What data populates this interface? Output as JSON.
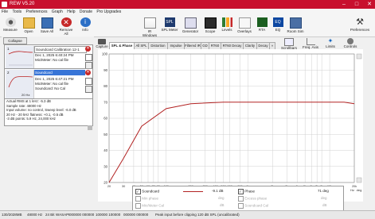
{
  "window": {
    "title": "REW V5.20"
  },
  "menu": [
    "File",
    "Tools",
    "Preferences",
    "Graph",
    "Help",
    "Donate",
    "Pro Upgrades"
  ],
  "toolbar": [
    {
      "label": "Measure",
      "icon": "measure-icon"
    },
    {
      "label": "Open",
      "icon": "open-icon"
    },
    {
      "label": "Save All",
      "icon": "save-icon"
    },
    {
      "label": "Remove All",
      "icon": "remove-icon"
    },
    {
      "label": "Info",
      "icon": "info-icon"
    }
  ],
  "toolbar_right": [
    {
      "label": "IR Windows",
      "icon": "ir-windows-icon"
    },
    {
      "label": "SPL Meter",
      "icon": "spl-meter-icon"
    },
    {
      "label": "Generator",
      "icon": "generator-icon"
    },
    {
      "label": "Scope",
      "icon": "scope-icon"
    },
    {
      "label": "Levels",
      "icon": "levels-icon"
    },
    {
      "label": "Overlays",
      "icon": "overlays-icon"
    },
    {
      "label": "RTA",
      "icon": "rta-icon"
    },
    {
      "label": "EQ",
      "icon": "eq-icon"
    },
    {
      "label": "Room Sim",
      "icon": "room-sim-icon"
    }
  ],
  "preferences_label": "Preferences",
  "collapse_label": "Collapse",
  "measurements": [
    {
      "name": "Soundcard Calibration 12-1",
      "date": "Dec 1, 2025 6:40:24 PM",
      "mic": "Mic/Meter: No cal file",
      "range": "20 Hz",
      "thumb_num": "1"
    },
    {
      "name": "Soundcard",
      "date": "Dec 1, 2025 6:47:21 PM",
      "mic": "Mic/Meter: No cal file",
      "cal": "Soundcard: No Cal",
      "range": "20 Hz",
      "thumb_num": "2"
    }
  ],
  "stats": [
    "Actual RMS at 1 kHz: -5.3 dB",
    "Sample rate: 48000 Hz",
    "Input volume: no control, Sweep level: -6.0 dB",
    "20 Hz - 20 kHz flatness: +0.1, -0.5 dB",
    "-3 dB points: 5.9 Hz, 24,000 kHz"
  ],
  "graph_tabs": [
    "SPL & Phase",
    "All SPL",
    "Distortion",
    "Impulse",
    "Filtered IR",
    "GD",
    "RT60",
    "RT60 Decay",
    "Clarity",
    "Decay"
  ],
  "capture_label": "Capture",
  "right_tools": [
    {
      "label": "Scrollbars"
    },
    {
      "label": "Freq. Axis"
    },
    {
      "label": "Limits"
    },
    {
      "label": "Controls"
    }
  ],
  "y_ticks": [
    "100",
    "90",
    "80",
    "70",
    "60",
    "50",
    "40",
    "30",
    "20"
  ],
  "x_ticks": [
    "20",
    "30",
    "40",
    "50",
    "60",
    "70",
    "80",
    "100",
    "200",
    "300",
    "400",
    "500",
    "600",
    "800",
    "1k",
    "2k",
    "3k",
    "4k",
    "5k",
    "6k",
    "7k",
    "8k",
    "10k",
    "20k"
  ],
  "plot_labels": {
    "y_unit": "dB SPL",
    "x_unit": "Hz",
    "right_unit": "deg"
  },
  "legend": [
    {
      "name": "Soundcard",
      "value": "-9.1 dB",
      "checked": true,
      "color": "#b22222"
    },
    {
      "name": "Min phase",
      "value": "deg",
      "checked": false,
      "color": "#aaaaaa"
    },
    {
      "name": "Mic/Meter Cal",
      "value": "dB",
      "checked": false,
      "color": "#aaaaaa"
    }
  ],
  "legend_right": [
    {
      "name": "Phase",
      "value": "71 deg",
      "checked": true
    },
    {
      "name": "Excess phase",
      "value": "deg",
      "checked": false
    },
    {
      "name": "Soundcard Cal",
      "value": "dB",
      "checked": false
    }
  ],
  "status": {
    "buffer": "130/2028MB",
    "rate": "48000 Hz",
    "bits": "24 Bit",
    "mode": "WASAPI",
    "bits1": "000000 000000",
    "bits2": "100000 100000",
    "bits3": "000000 000000",
    "message": "Peak input before clipping 120 dB SPL (uncalibrated)"
  },
  "chart_data": {
    "type": "line",
    "series": [
      {
        "name": "Soundcard",
        "x": [
          20,
          30,
          50,
          100,
          200,
          500,
          1000,
          2000,
          5000,
          10000,
          15000,
          20000
        ],
        "values": [
          20,
          35,
          55,
          66,
          69,
          70,
          70,
          70,
          70,
          70,
          70,
          69
        ]
      }
    ],
    "x_scale": "log",
    "xlim": [
      20,
      20000
    ],
    "ylim": [
      20,
      100
    ],
    "ylabel": "dB SPL"
  }
}
